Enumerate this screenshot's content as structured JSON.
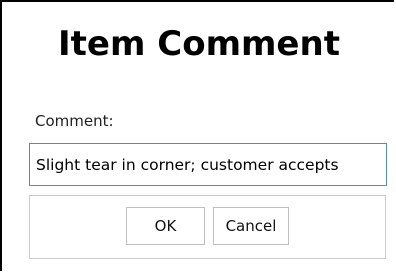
{
  "dialog": {
    "title": "Item Comment",
    "comment_label": "Comment:",
    "comment_value": "Slight tear in corner; customer accepts",
    "ok_label": "OK",
    "cancel_label": "Cancel"
  }
}
